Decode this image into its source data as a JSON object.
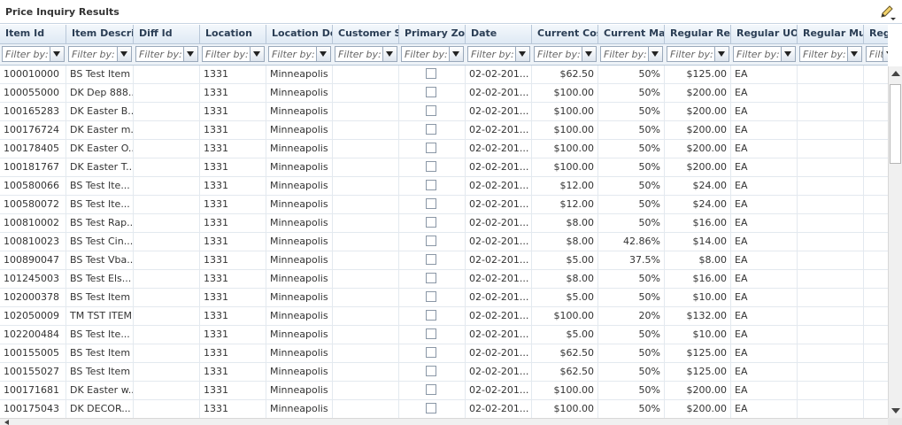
{
  "panel": {
    "title": "Price Inquiry Results"
  },
  "icons": {
    "edit": "pencil-icon",
    "filter_dropdown": "chevron-down-icon"
  },
  "filter_placeholder": "Filter by:",
  "columns": [
    {
      "key": "item_id",
      "label": "Item Id"
    },
    {
      "key": "item_desc",
      "label": "Item Description"
    },
    {
      "key": "diff_id",
      "label": "Diff Id"
    },
    {
      "key": "location",
      "label": "Location"
    },
    {
      "key": "location_desc",
      "label": "Location Description"
    },
    {
      "key": "customer_segment",
      "label": "Customer Segment"
    },
    {
      "key": "primary_zone",
      "label": "Primary Zone"
    },
    {
      "key": "date",
      "label": "Date"
    },
    {
      "key": "current_cost",
      "label": "Current Cost"
    },
    {
      "key": "current_markup",
      "label": "Current Markup"
    },
    {
      "key": "regular_retail",
      "label": "Regular Retail"
    },
    {
      "key": "regular_uom",
      "label": "Regular UOM"
    },
    {
      "key": "regular_multi",
      "label": "Regular Multi"
    },
    {
      "key": "reg",
      "label": "Reg"
    }
  ],
  "rows": [
    {
      "item_id": "100010000",
      "item_desc": "BS Test Item",
      "location": "1331",
      "location_desc": "Minneapolis",
      "date": "02-02-201...",
      "current_cost": "$62.50",
      "current_markup": "50%",
      "regular_retail": "$125.00",
      "regular_uom": "EA"
    },
    {
      "item_id": "100055000",
      "item_desc": "DK Dep 888...",
      "location": "1331",
      "location_desc": "Minneapolis",
      "date": "02-02-201...",
      "current_cost": "$100.00",
      "current_markup": "50%",
      "regular_retail": "$200.00",
      "regular_uom": "EA"
    },
    {
      "item_id": "100165283",
      "item_desc": "DK Easter B...",
      "location": "1331",
      "location_desc": "Minneapolis",
      "date": "02-02-201...",
      "current_cost": "$100.00",
      "current_markup": "50%",
      "regular_retail": "$200.00",
      "regular_uom": "EA"
    },
    {
      "item_id": "100176724",
      "item_desc": "DK Easter m...",
      "location": "1331",
      "location_desc": "Minneapolis",
      "date": "02-02-201...",
      "current_cost": "$100.00",
      "current_markup": "50%",
      "regular_retail": "$200.00",
      "regular_uom": "EA"
    },
    {
      "item_id": "100178405",
      "item_desc": "DK Easter O...",
      "location": "1331",
      "location_desc": "Minneapolis",
      "date": "02-02-201...",
      "current_cost": "$100.00",
      "current_markup": "50%",
      "regular_retail": "$200.00",
      "regular_uom": "EA"
    },
    {
      "item_id": "100181767",
      "item_desc": "DK Easter T...",
      "location": "1331",
      "location_desc": "Minneapolis",
      "date": "02-02-201...",
      "current_cost": "$100.00",
      "current_markup": "50%",
      "regular_retail": "$200.00",
      "regular_uom": "EA"
    },
    {
      "item_id": "100580066",
      "item_desc": "BS Test Ite...",
      "location": "1331",
      "location_desc": "Minneapolis",
      "date": "02-02-201...",
      "current_cost": "$12.00",
      "current_markup": "50%",
      "regular_retail": "$24.00",
      "regular_uom": "EA"
    },
    {
      "item_id": "100580072",
      "item_desc": "BS Test Ite...",
      "location": "1331",
      "location_desc": "Minneapolis",
      "date": "02-02-201...",
      "current_cost": "$12.00",
      "current_markup": "50%",
      "regular_retail": "$24.00",
      "regular_uom": "EA"
    },
    {
      "item_id": "100810002",
      "item_desc": "BS Test Rap...",
      "location": "1331",
      "location_desc": "Minneapolis",
      "date": "02-02-201...",
      "current_cost": "$8.00",
      "current_markup": "50%",
      "regular_retail": "$16.00",
      "regular_uom": "EA"
    },
    {
      "item_id": "100810023",
      "item_desc": "BS Test Cin...",
      "location": "1331",
      "location_desc": "Minneapolis",
      "date": "02-02-201...",
      "current_cost": "$8.00",
      "current_markup": "42.86%",
      "regular_retail": "$14.00",
      "regular_uom": "EA"
    },
    {
      "item_id": "100890047",
      "item_desc": "BS Test Vba...",
      "location": "1331",
      "location_desc": "Minneapolis",
      "date": "02-02-201...",
      "current_cost": "$5.00",
      "current_markup": "37.5%",
      "regular_retail": "$8.00",
      "regular_uom": "EA"
    },
    {
      "item_id": "101245003",
      "item_desc": "BS Test Els...",
      "location": "1331",
      "location_desc": "Minneapolis",
      "date": "02-02-201...",
      "current_cost": "$8.00",
      "current_markup": "50%",
      "regular_retail": "$16.00",
      "regular_uom": "EA"
    },
    {
      "item_id": "102000378",
      "item_desc": "BS Test Item",
      "location": "1331",
      "location_desc": "Minneapolis",
      "date": "02-02-201...",
      "current_cost": "$5.00",
      "current_markup": "50%",
      "regular_retail": "$10.00",
      "regular_uom": "EA"
    },
    {
      "item_id": "102050009",
      "item_desc": "TM TST ITEM",
      "location": "1331",
      "location_desc": "Minneapolis",
      "date": "02-02-201...",
      "current_cost": "$100.00",
      "current_markup": "20%",
      "regular_retail": "$132.00",
      "regular_uom": "EA"
    },
    {
      "item_id": "102200484",
      "item_desc": "BS Test Ite...",
      "location": "1331",
      "location_desc": "Minneapolis",
      "date": "02-02-201...",
      "current_cost": "$5.00",
      "current_markup": "50%",
      "regular_retail": "$10.00",
      "regular_uom": "EA"
    },
    {
      "item_id": "100155005",
      "item_desc": "BS Test Item",
      "location": "1331",
      "location_desc": "Minneapolis",
      "date": "02-02-201...",
      "current_cost": "$62.50",
      "current_markup": "50%",
      "regular_retail": "$125.00",
      "regular_uom": "EA"
    },
    {
      "item_id": "100155027",
      "item_desc": "BS Test Item",
      "location": "1331",
      "location_desc": "Minneapolis",
      "date": "02-02-201...",
      "current_cost": "$62.50",
      "current_markup": "50%",
      "regular_retail": "$125.00",
      "regular_uom": "EA"
    },
    {
      "item_id": "100171681",
      "item_desc": "DK Easter w...",
      "location": "1331",
      "location_desc": "Minneapolis",
      "date": "02-02-201...",
      "current_cost": "$100.00",
      "current_markup": "50%",
      "regular_retail": "$200.00",
      "regular_uom": "EA"
    },
    {
      "item_id": "100175043",
      "item_desc": "DK DECOR...",
      "location": "1331",
      "location_desc": "Minneapolis",
      "date": "02-02-201...",
      "current_cost": "$100.00",
      "current_markup": "50%",
      "regular_retail": "$200.00",
      "regular_uom": "EA"
    }
  ]
}
